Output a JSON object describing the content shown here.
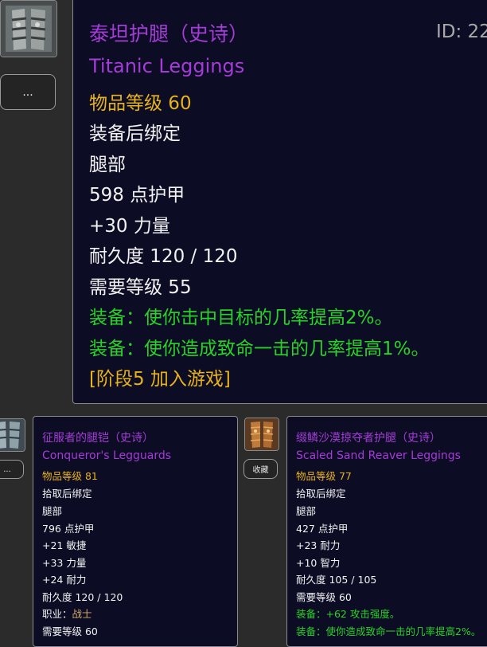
{
  "main_item": {
    "name_cn": "泰坦护腿（史诗）",
    "name_en": "Titanic Leggings",
    "id_label": "ID: 22",
    "lines": [
      {
        "text": "物品等级 60",
        "color": "gold"
      },
      {
        "text": "装备后绑定",
        "color": "white"
      },
      {
        "text": "腿部",
        "color": "white"
      },
      {
        "text": "598 点护甲",
        "color": "white"
      },
      {
        "text": "+30 力量",
        "color": "white"
      },
      {
        "text": "耐久度 120 / 120",
        "color": "white"
      },
      {
        "text": "需要等级 55",
        "color": "white"
      },
      {
        "text": "装备：使你击中目标的几率提高2%。",
        "color": "green"
      },
      {
        "text": "装备：使你造成致命一击的几率提高1%。",
        "color": "green"
      },
      {
        "text": "[阶段5 加入游戏]",
        "color": "gold"
      }
    ],
    "more_button": "..."
  },
  "left_item": {
    "name_cn": "征服者的腿铠（史诗）",
    "name_en": "Conqueror's Legguards",
    "item_level": "物品等级 81",
    "bind": "拾取后绑定",
    "slot": "腿部",
    "armor": "796 点护甲",
    "stat1": "+21 敏捷",
    "stat2": "+33 力量",
    "stat3": "+24 耐力",
    "durability": "耐久度 120 / 120",
    "class_label": "职业：",
    "class_value": "战士",
    "req_level": "需要等级 60",
    "more_button": "..."
  },
  "right_item": {
    "name_cn": "缀鳞沙漠掠夺者护腿（史诗）",
    "name_en": "Scaled Sand Reaver Leggings",
    "item_level": "物品等级 77",
    "bind": "拾取后绑定",
    "slot": "腿部",
    "armor": "427 点护甲",
    "stat1": "+23 耐力",
    "stat2": "+10 智力",
    "durability": "耐久度 105 / 105",
    "req_level": "需要等级 60",
    "equip1": "装备：+62 攻击强度。",
    "equip2": "装备：使你造成致命一击的几率提高2%。",
    "collect_button": "收藏"
  },
  "colors": {
    "epic": "#a53bd8",
    "gold": "#e8b21b",
    "green": "#29d229",
    "panel_bg": "#0c0d24"
  }
}
